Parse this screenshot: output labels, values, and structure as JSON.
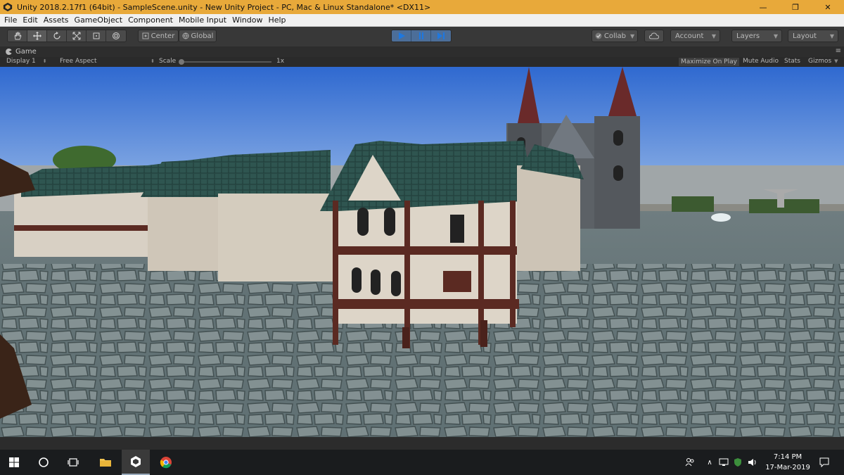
{
  "window": {
    "title": "Unity 2018.2.17f1 (64bit) - SampleScene.unity - New Unity Project - PC, Mac & Linux Standalone* <DX11>",
    "controls": [
      "—",
      "❐",
      "✕"
    ]
  },
  "menu": {
    "items": [
      "File",
      "Edit",
      "Assets",
      "GameObject",
      "Component",
      "Mobile Input",
      "Window",
      "Help"
    ]
  },
  "toolbar": {
    "pivot_label": "Center",
    "space_label": "Global",
    "collab_label": "Collab",
    "account_label": "Account",
    "layers_label": "Layers",
    "layout_label": "Layout"
  },
  "game_panel": {
    "tab_label": "Game",
    "display_label": "Display 1",
    "aspect_label": "Free Aspect",
    "scale_label": "Scale",
    "scale_value": "1x",
    "maximize_label": "Maximize On Play",
    "mute_label": "Mute Audio",
    "stats_label": "Stats",
    "gizmos_label": "Gizmos"
  },
  "taskbar": {
    "time": "7:14 PM",
    "date": "17-Mar-2019"
  },
  "colors": {
    "title_bar": "#e8a93a",
    "play_accent": "#4c6e99",
    "sky_top": "#2f69d0",
    "sky_bottom": "#a9c6ec",
    "ground": "#5d6c6e"
  }
}
